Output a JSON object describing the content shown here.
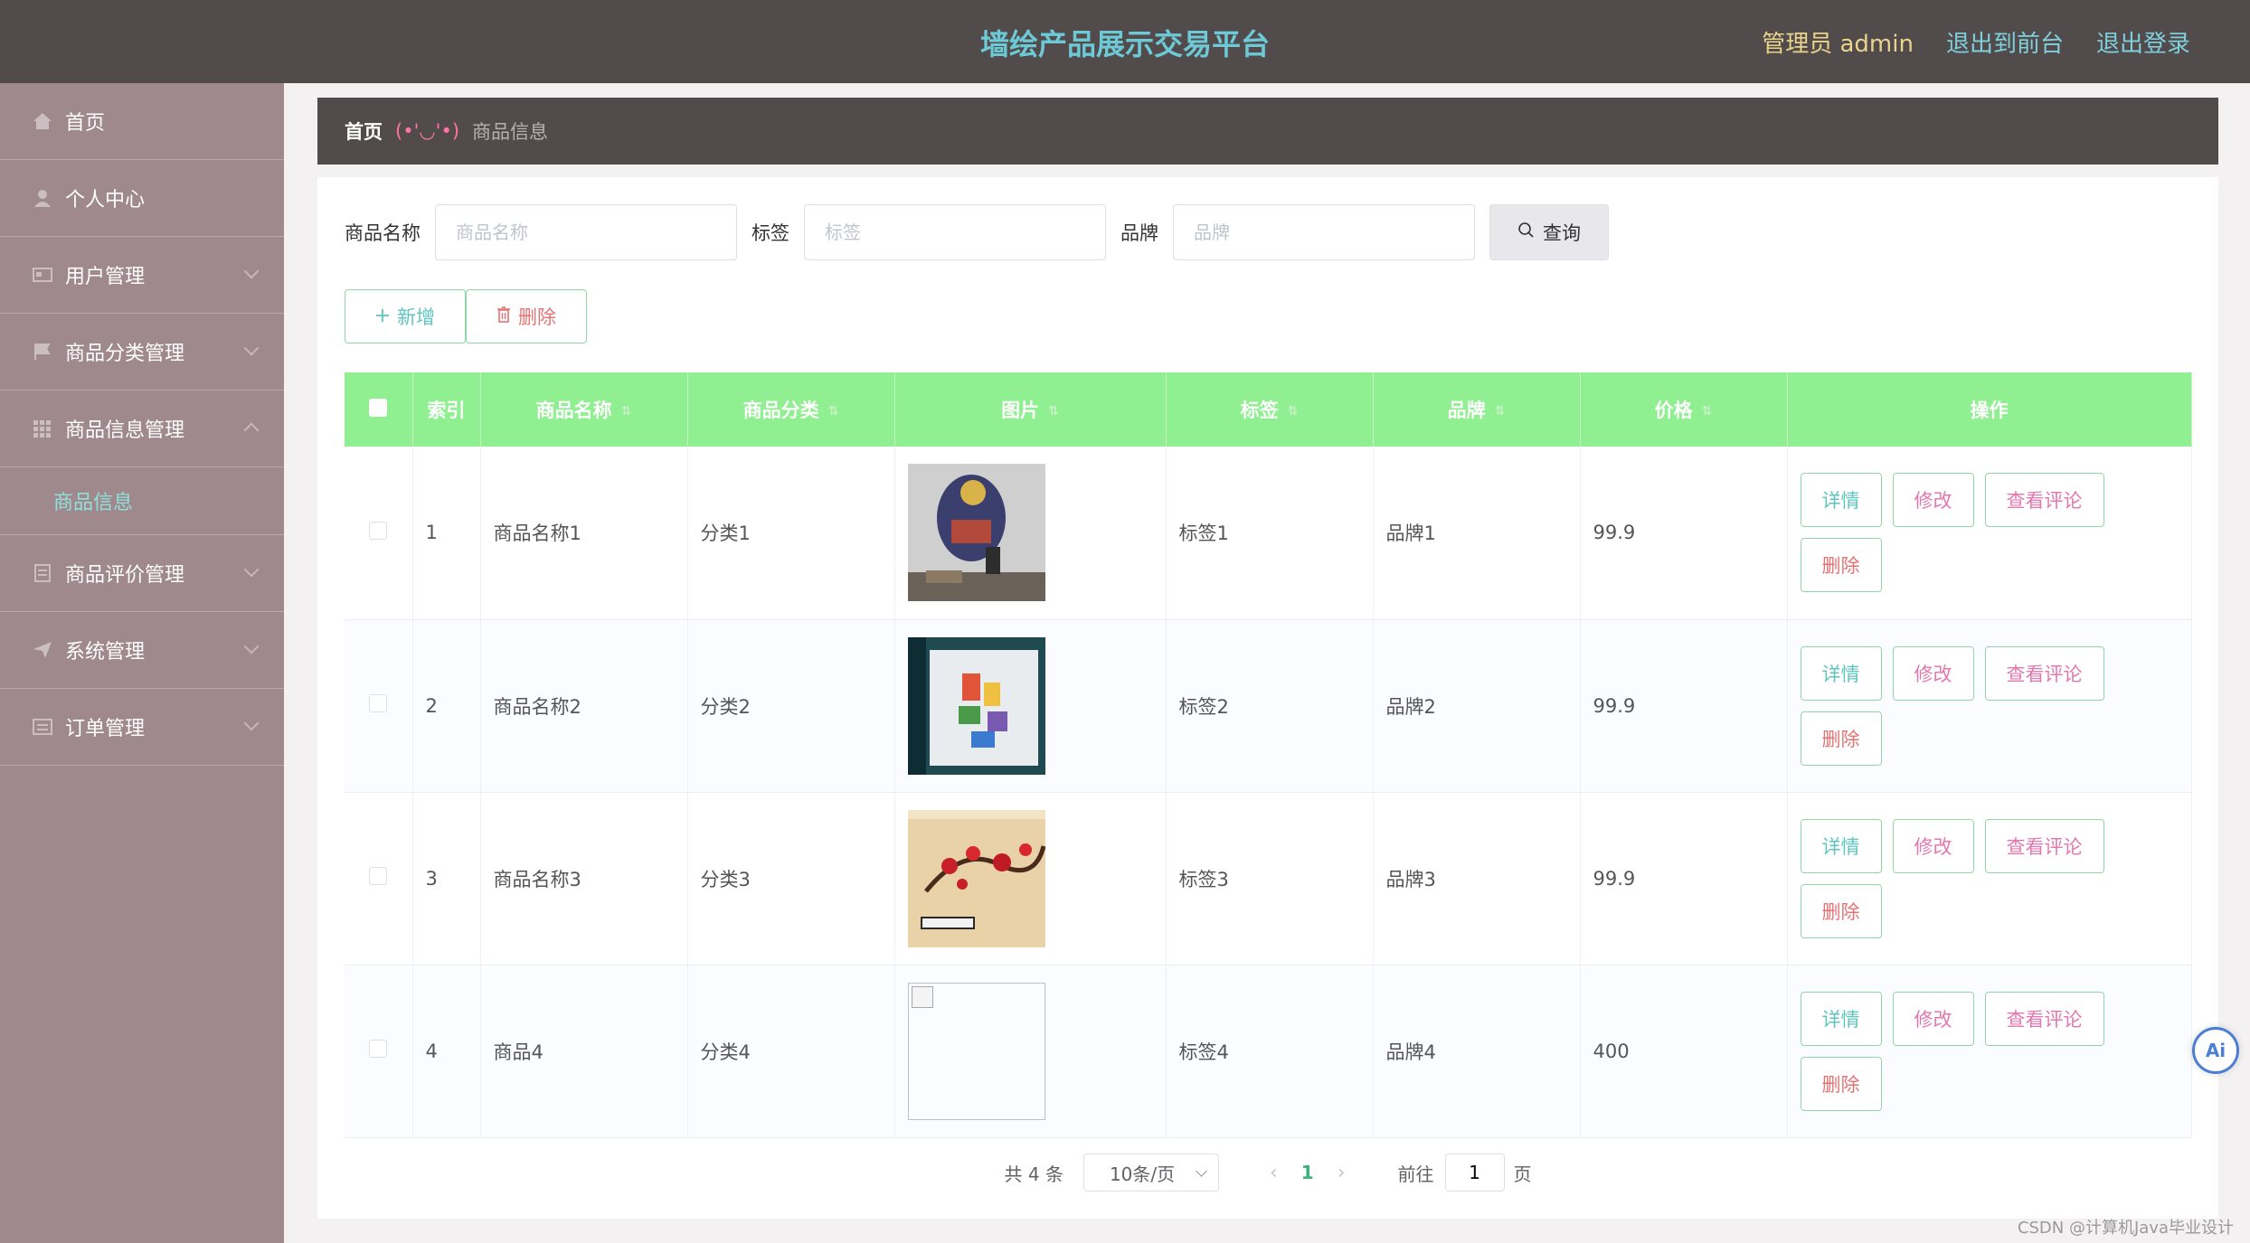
{
  "header": {
    "title": "墙绘产品展示交易平台",
    "admin_label": "管理员 admin",
    "front_link": "退出到前台",
    "logout_link": "退出登录"
  },
  "sidebar": {
    "items": [
      {
        "label": "首页",
        "icon": "home-icon"
      },
      {
        "label": "个人中心",
        "icon": "user-icon"
      },
      {
        "label": "用户管理",
        "icon": "card-icon"
      },
      {
        "label": "商品分类管理",
        "icon": "flag-icon"
      },
      {
        "label": "商品信息管理",
        "icon": "grid-icon"
      },
      {
        "label": "商品评价管理",
        "icon": "doc-icon"
      },
      {
        "label": "系统管理",
        "icon": "send-icon"
      },
      {
        "label": "订单管理",
        "icon": "list-icon"
      }
    ],
    "active_sub": "商品信息"
  },
  "breadcrumb": {
    "home": "首页",
    "separator": "(•'◡'•)",
    "current": "商品信息"
  },
  "search": {
    "name_label": "商品名称",
    "name_placeholder": "商品名称",
    "tag_label": "标签",
    "tag_placeholder": "标签",
    "brand_label": "品牌",
    "brand_placeholder": "品牌",
    "query_label": "查询"
  },
  "actions": {
    "add_label": "新增",
    "delete_label": "删除"
  },
  "table": {
    "headers": {
      "index": "索引",
      "name": "商品名称",
      "category": "商品分类",
      "image": "图片",
      "tag": "标签",
      "brand": "品牌",
      "price": "价格",
      "ops": "操作"
    },
    "op_labels": {
      "detail": "详情",
      "edit": "修改",
      "review": "查看评论",
      "remove": "删除"
    },
    "rows": [
      {
        "index": "1",
        "name": "商品名称1",
        "category": "分类1",
        "tag": "标签1",
        "brand": "品牌1",
        "price": "99.9"
      },
      {
        "index": "2",
        "name": "商品名称2",
        "category": "分类2",
        "tag": "标签2",
        "brand": "品牌2",
        "price": "99.9"
      },
      {
        "index": "3",
        "name": "商品名称3",
        "category": "分类3",
        "tag": "标签3",
        "brand": "品牌3",
        "price": "99.9"
      },
      {
        "index": "4",
        "name": "商品4",
        "category": "分类4",
        "tag": "标签4",
        "brand": "品牌4",
        "price": "400"
      }
    ]
  },
  "pagination": {
    "total": "共 4 条",
    "page_size": "10条/页",
    "current_page": "1",
    "goto_label": "前往",
    "goto_value": "1",
    "page_suffix": "页"
  },
  "ai_button": "Ai",
  "watermark": "CSDN @计算机Java毕业设计",
  "colors": {
    "header_bg": "#524b4c",
    "sidebar_bg": "#9f898c",
    "table_header_bg": "#90ef90",
    "title_color": "#6ec9d6",
    "accent_pink": "#e477b0"
  }
}
